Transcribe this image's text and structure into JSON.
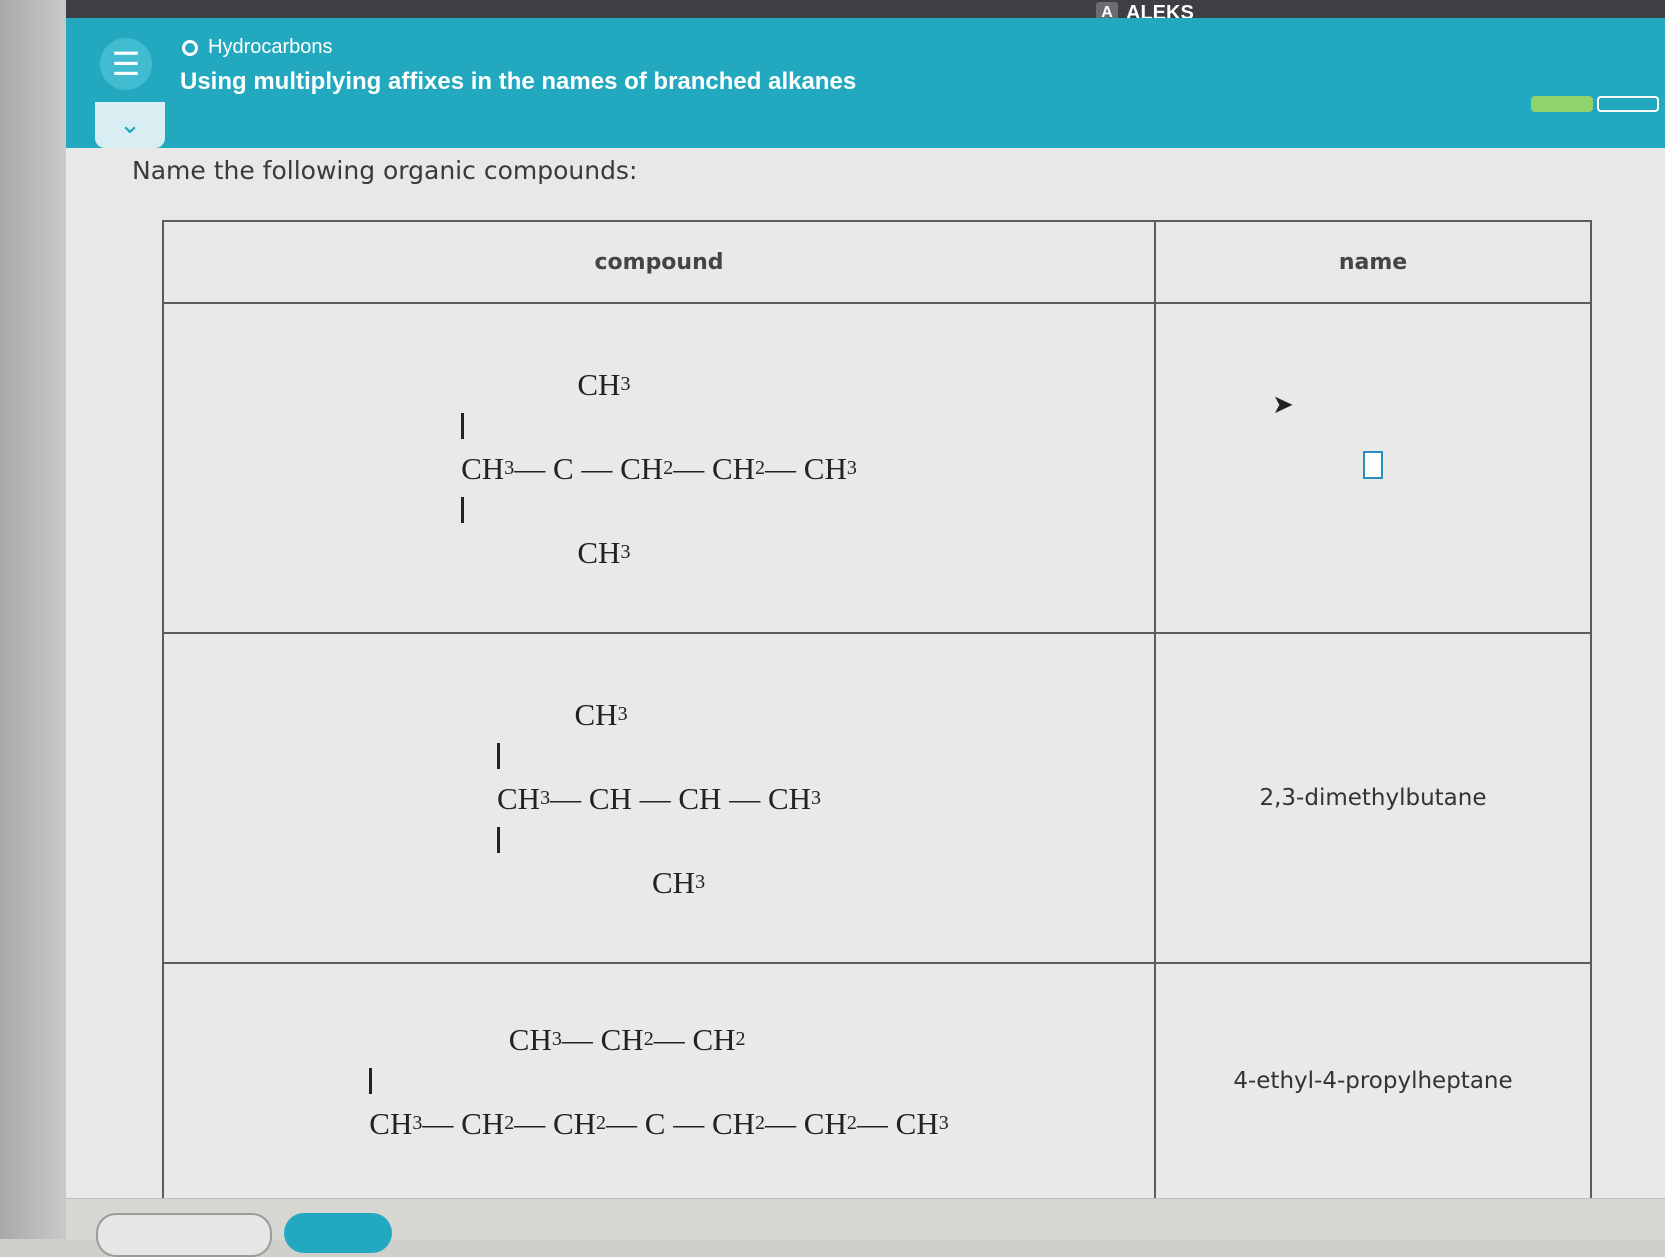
{
  "app": {
    "brand": "ALEKS",
    "brand_badge": "A"
  },
  "header": {
    "topic": "Hydrocarbons",
    "lesson_title": "Using multiplying affixes in the names of branched alkanes",
    "progress": {
      "filled_segments": 1,
      "total_segments": 2
    }
  },
  "main": {
    "instruction": "Name the following organic compounds:",
    "table": {
      "columns": [
        "compound",
        "name"
      ],
      "rows": [
        {
          "formula_lines": [
            "               CH3",
            "               |",
            "CH3— C — CH2— CH2— CH3",
            "               |",
            "               CH3"
          ],
          "name": ""
        },
        {
          "formula_lines": [
            "          CH3",
            "          |",
            "CH3— CH — CH — CH3",
            "                    |",
            "                    CH3"
          ],
          "name": "2,3-dimethylbutane"
        },
        {
          "formula_lines": [
            "                  CH3— CH2— CH2",
            "                                  |",
            "CH3— CH2— CH2— C — CH2— CH2— CH3"
          ],
          "name": "4-ethyl-4-propylheptane"
        }
      ]
    }
  },
  "icons": {
    "menu": "hamburger-menu-icon",
    "collapse": "chevron-down-icon",
    "cursor": "mouse-pointer-icon"
  },
  "colors": {
    "header": "#23a9bf",
    "progress_fill": "#8fd36a",
    "table_border": "#5c5c5c"
  }
}
